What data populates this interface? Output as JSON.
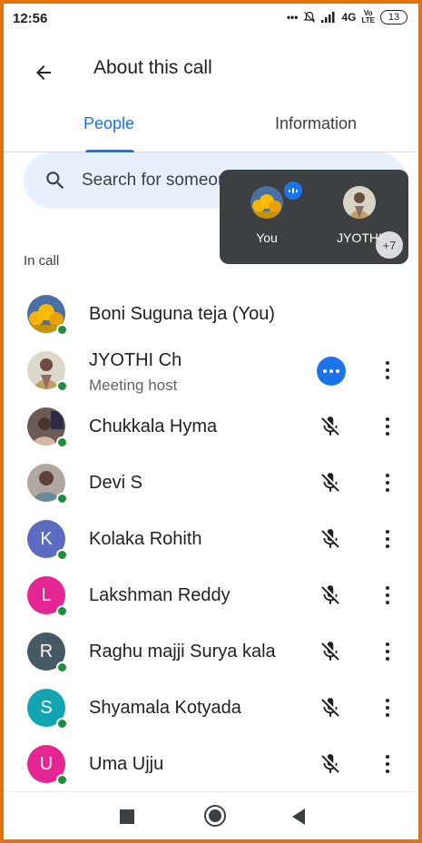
{
  "status_bar": {
    "time": "12:56",
    "network": "4G",
    "volte_top": "Vo",
    "volte_bottom": "LTE",
    "battery": "13"
  },
  "header": {
    "title": "About this call",
    "back_icon": "arrow-back-icon"
  },
  "tabs": [
    {
      "label": "People",
      "selected": true
    },
    {
      "label": "Information",
      "selected": false
    }
  ],
  "search": {
    "placeholder": "Search for someone"
  },
  "overlay": {
    "tiles": [
      {
        "name": "You"
      },
      {
        "name": "JYOTHI"
      }
    ],
    "more_count": "+7"
  },
  "section_label": "In call",
  "participants": [
    {
      "name": "Boni Suguna teja (You)",
      "subtitle": "",
      "avatar_type": "photo-flowers",
      "status": "none"
    },
    {
      "name": "JYOTHI Ch",
      "subtitle": "Meeting host",
      "avatar_type": "photo-person",
      "status": "speaking"
    },
    {
      "name": "Chukkala Hyma",
      "subtitle": "",
      "avatar_type": "photo-person",
      "status": "muted"
    },
    {
      "name": "Devi S",
      "subtitle": "",
      "avatar_type": "photo-person",
      "status": "muted"
    },
    {
      "name": "Kolaka Rohith",
      "subtitle": "",
      "avatar_letter": "K",
      "avatar_color": "#5c6bc0",
      "status": "muted"
    },
    {
      "name": "Lakshman Reddy",
      "subtitle": "",
      "avatar_letter": "L",
      "avatar_color": "#e52592",
      "status": "muted"
    },
    {
      "name": "Raghu majji Surya kala",
      "subtitle": "",
      "avatar_letter": "R",
      "avatar_color": "#455a64",
      "status": "muted"
    },
    {
      "name": "Shyamala Kotyada",
      "subtitle": "",
      "avatar_letter": "S",
      "avatar_color": "#12a4af",
      "status": "muted"
    },
    {
      "name": "Uma Ujju",
      "subtitle": "",
      "avatar_letter": "U",
      "avatar_color": "#e52592",
      "status": "muted"
    }
  ],
  "colors": {
    "accent": "#1a73e8",
    "online": "#1e8e3e",
    "frame": "#e8710a",
    "search_bg": "#e8f0fe"
  }
}
